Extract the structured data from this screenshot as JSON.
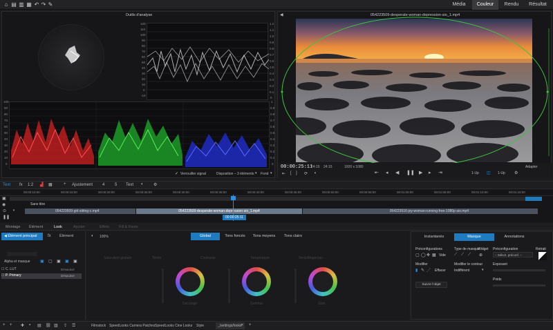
{
  "app": {
    "top_tabs": [
      "Média",
      "Couleur",
      "Rendu",
      "Résultat"
    ],
    "active_top_tab": "Couleur"
  },
  "scopes": {
    "title": "Outils d'analyse",
    "waveform_ticks": [
      "120",
      "110",
      "100",
      "90",
      "80",
      "70",
      "60",
      "50",
      "40",
      "30",
      "20",
      "10",
      "0",
      "-10"
    ],
    "waveform_right_ticks": [
      "1.2",
      "1.1",
      "1.0",
      "0.9",
      "0.8",
      "0.7",
      "0.6",
      "0.5",
      "0.4",
      "0.3",
      "0.2",
      "0.1",
      "0"
    ],
    "parade_ticks": [
      "100",
      "90",
      "80",
      "70",
      "60",
      "50",
      "40",
      "30",
      "20",
      "10",
      "0"
    ],
    "parade_right_ticks": [
      "1",
      "0.9",
      "0.8",
      "0.7",
      "0.6",
      "0.5",
      "0.4",
      "0.3",
      "0.2",
      "0.1",
      "0"
    ],
    "footer_lock": "Verrouiller signal",
    "footer_layout": "Disposition – 3 éléments",
    "footer_scope": "Fond"
  },
  "viewer": {
    "title": "054223509-desperate-woman-depression-sio_1.mp4",
    "timecode": "00:00:25:11",
    "fps1": "24:15",
    "fps2": "24:15",
    "resolution": "1920 x 1080",
    "view_1": "1-Up",
    "view_2": "1-Up",
    "zoom": "Adapter"
  },
  "timeline": {
    "tab_text": "Text",
    "tab_fx": "fx",
    "tab_1": "1:2",
    "tab_adjust": "Ajustement",
    "tab_4": "4",
    "tab_5": "5",
    "tab_text2": "Text",
    "ruler": [
      "00:00:10:00",
      "00:00:15:00",
      "00:00:20:00",
      "00:00:25:00",
      "00:00:30:00",
      "00:00:35:00",
      "00:00:40:00",
      "00:00:45:00",
      "00:00:50:00",
      "00:00:55:00",
      "00:01:00:00",
      "00:01:05:00",
      "00:01:10:00",
      "00:01:15:00"
    ],
    "track_label": "Sans titre",
    "clip_left": "054223509-girl-sitting-c.mp4",
    "clip_main": "054223509-desperate-woman-depression-sio_1.mp4",
    "clip_right": "054223516-joy-woman-running-free-1080p-sio.mp4",
    "playhead_tc": "00:00:25:11"
  },
  "lower_tabs": [
    "Montage",
    "Élément",
    "Look",
    "Ajuster",
    "Effets",
    "Fill & Paste"
  ],
  "active_lower_tab": "Look",
  "left_panel": {
    "element_tab": "Élément principal",
    "fx_tab": "fx",
    "element2_tab": "Élément",
    "alpha_label": "Alpha et masque",
    "layers": [
      {
        "name": "C. LUT",
        "status": "Désactivé",
        "selected": false
      },
      {
        "name": "P. Primary",
        "status": "Désactivé",
        "selected": true
      }
    ]
  },
  "color_panel": {
    "percent": "100%",
    "range_tabs": [
      "Global",
      "Tons foncés",
      "Tons moyens",
      "Tons clairs"
    ],
    "active_range": "Global",
    "param_labels": [
      "Saturation globale",
      "Teinte",
      "Contraste",
      "Température",
      "Verts/Magentas"
    ],
    "wheel_labels": [
      "Décalage",
      "Gamma",
      "Gain"
    ]
  },
  "mask_panel": {
    "tabs": [
      "Instantanés",
      "Masque",
      "Annotations"
    ],
    "active_tab": "Masque",
    "presets_label": "Préconfigurations",
    "mask_type_label": "Type de masque",
    "widget_label": "Widget",
    "presets2_label": "Préconfiguration",
    "retract_label": "Retrait",
    "view_label": "Vide",
    "select_preset": "– Sélect. préconf. –",
    "modify_label": "Modifier",
    "erase_label": "Effacer",
    "contour_label": "Modifier le contour",
    "contour_value": "Indifférent",
    "exposure_label": "Exposant",
    "weight_label": "Poids",
    "track_button": "Suivre l'objet"
  },
  "bottom_tabs": [
    "Filmstock",
    "SpeedLooks Camera Patches",
    "SpeedLooks Cine Looks",
    "Style",
    "_/settings/looks"
  ],
  "colors": {
    "accent": "#1f7bbf",
    "playhead": "#2a8fe0",
    "green_guide": "#39c43c"
  }
}
